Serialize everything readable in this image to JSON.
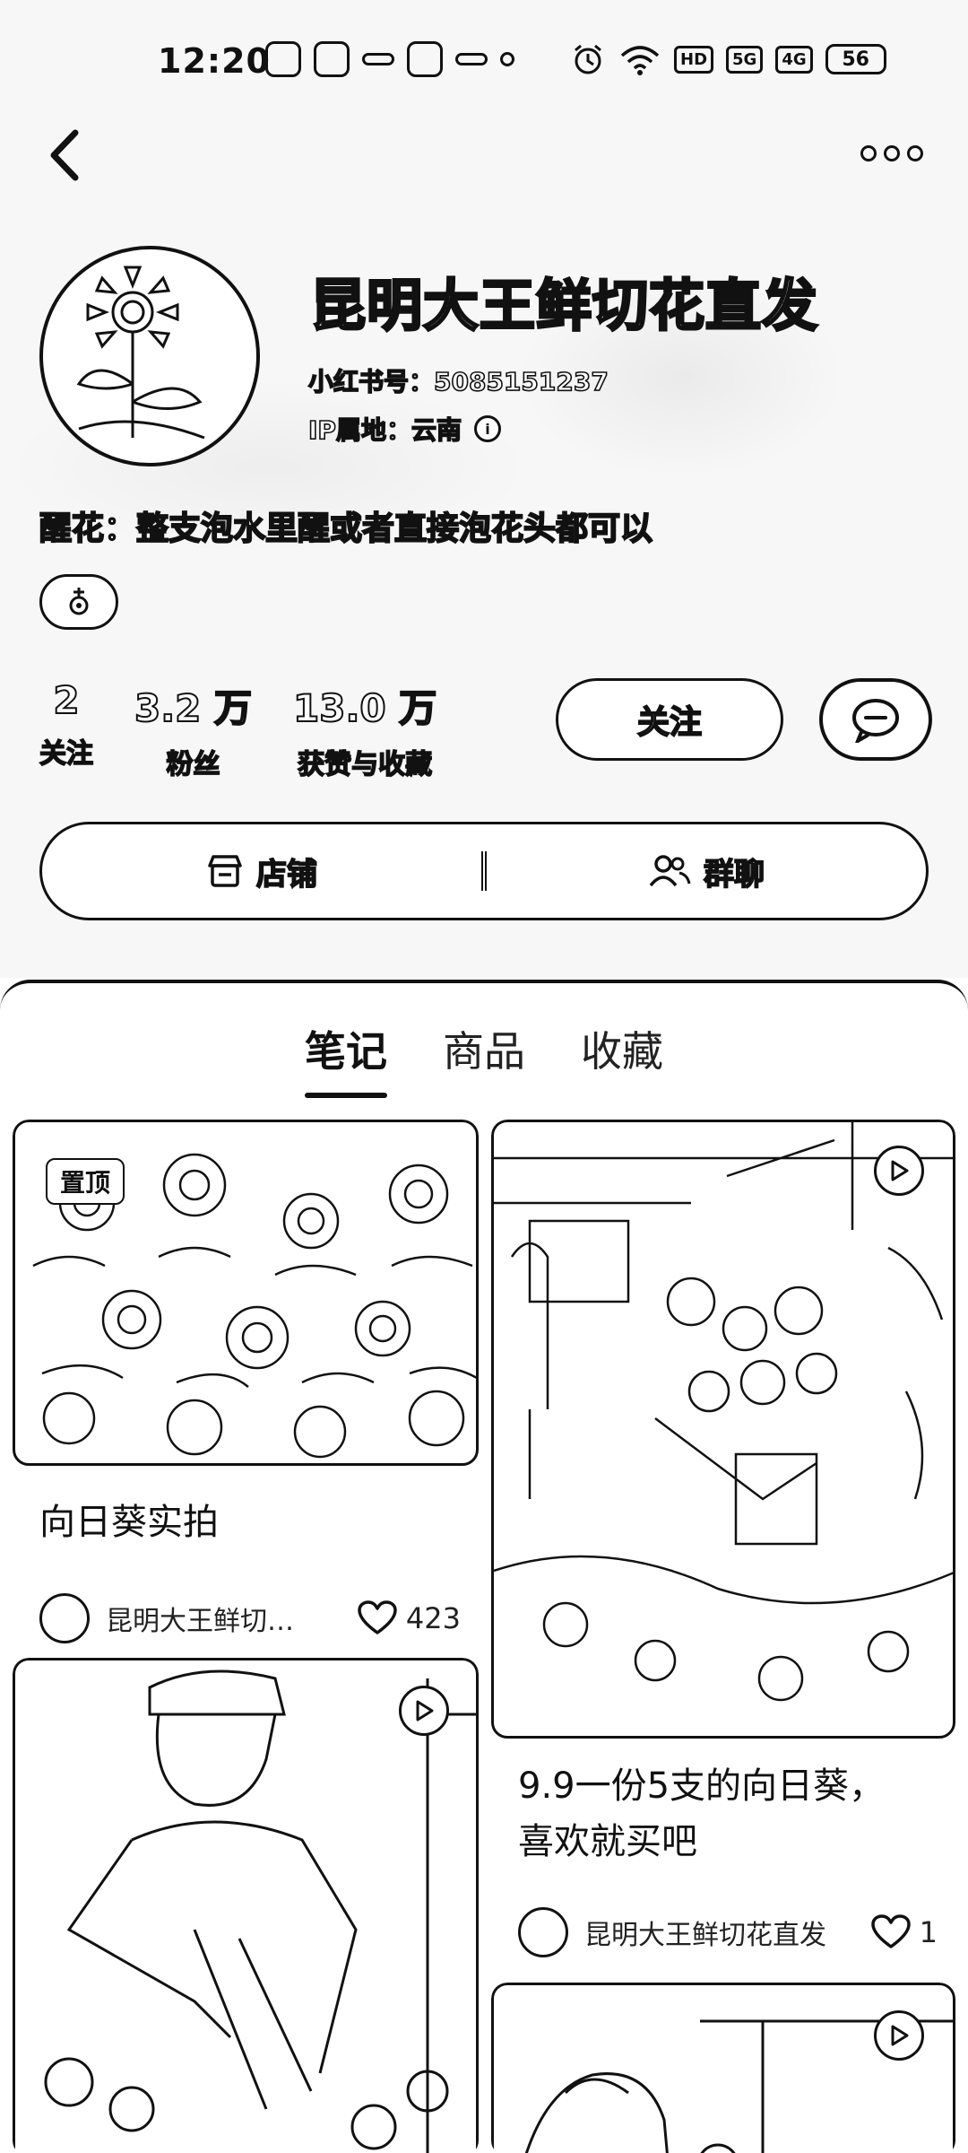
{
  "status_bar": {
    "time": "12:20",
    "badge_text": "HD",
    "signal_1": "5G",
    "signal_2": "4G",
    "battery": "56"
  },
  "profile": {
    "name": "昆明大王鲜切花直发",
    "id_line": "小红书号：5085151237",
    "ip_line": "IP属地：云南",
    "bio": "醒花：整支泡水里醒或者直接泡花头都可以",
    "stats": [
      {
        "value": "2",
        "label": "关注"
      },
      {
        "value": "3.2 万",
        "label": "粉丝"
      },
      {
        "value": "13.0 万",
        "label": "获赞与收藏"
      }
    ],
    "follow_label": "关注"
  },
  "shop_bar": {
    "shop_label": "店铺",
    "group_label": "群聊"
  },
  "tabs": [
    {
      "label": "笔记",
      "active": true
    },
    {
      "label": "商品",
      "active": false
    },
    {
      "label": "收藏",
      "active": false
    }
  ],
  "cards": [
    {
      "title": "向日葵实拍",
      "badge": "置顶",
      "author": "昆明大王鲜切…",
      "likes": "423"
    },
    {
      "title_line1": "9.9一份5支的向日葵，",
      "title_line2": "喜欢就买吧",
      "author": "昆明大王鲜切花直发",
      "likes": "1"
    },
    {},
    {}
  ],
  "colors": {
    "ink": "#111111",
    "background": "#ffffff"
  }
}
